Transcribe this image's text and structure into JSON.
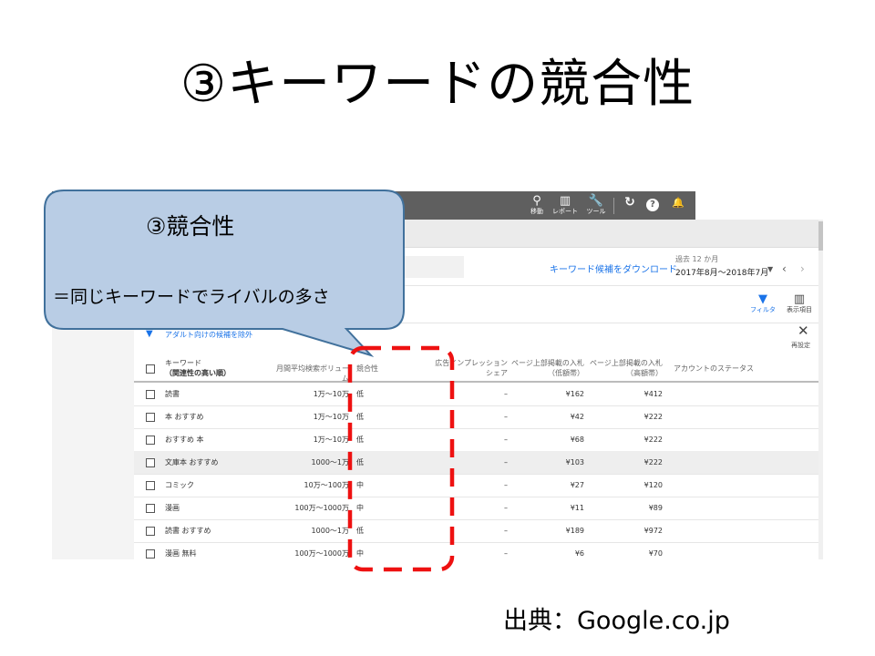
{
  "slide": {
    "title": "③キーワードの競合性",
    "source": "出典：Google.co.jp"
  },
  "callout": {
    "title": "③競合性",
    "text": "＝同じキーワードでライバルの多さ"
  },
  "topbar": {
    "items": [
      {
        "icon": "search-icon",
        "glyph": "⚲",
        "label": "移動"
      },
      {
        "icon": "report-icon",
        "glyph": "▥",
        "label": "レポート"
      },
      {
        "icon": "wrench-icon",
        "glyph": "🔧",
        "label": "ツール"
      }
    ],
    "refresh_glyph": "↻",
    "help_glyph": "?",
    "bell_glyph": "🔔"
  },
  "toolbar": {
    "download_label": "キーワード候補をダウンロード",
    "period_label": "過去 12 か月",
    "period_value": "2017年8月～2018年7月",
    "filter_label": "フィルタ",
    "columns_label": "表示項目",
    "adult_filter": "アダルト向けの候補を除外",
    "reset_label": "再設定"
  },
  "table": {
    "headers": {
      "keyword": "キーワード",
      "keyword_sub": "（関連性の高い順）",
      "volume": "月間平均検索ボリューム",
      "competition": "競合性",
      "impression_1": "広告インプレッション",
      "impression_2": "シェア",
      "bid_low_1": "ページ上部掲載の入札単価",
      "bid_low_2": "（低額帯）",
      "bid_high_1": "ページ上部掲載の入札単価",
      "bid_high_2": "（高額帯）",
      "status": "アカウントのステータス"
    },
    "rows": [
      {
        "keyword": "読書",
        "volume": "1万～10万",
        "competition": "低",
        "impression": "–",
        "bid_low": "¥162",
        "bid_high": "¥412"
      },
      {
        "keyword": "本 おすすめ",
        "volume": "1万～10万",
        "competition": "低",
        "impression": "–",
        "bid_low": "¥42",
        "bid_high": "¥222"
      },
      {
        "keyword": "おすすめ 本",
        "volume": "1万～10万",
        "competition": "低",
        "impression": "–",
        "bid_low": "¥68",
        "bid_high": "¥222"
      },
      {
        "keyword": "文庫本 おすすめ",
        "volume": "1000～1万",
        "competition": "低",
        "impression": "–",
        "bid_low": "¥103",
        "bid_high": "¥222"
      },
      {
        "keyword": "コミック",
        "volume": "10万～100万",
        "competition": "中",
        "impression": "–",
        "bid_low": "¥27",
        "bid_high": "¥120"
      },
      {
        "keyword": "漫画",
        "volume": "100万～1000万",
        "competition": "中",
        "impression": "–",
        "bid_low": "¥11",
        "bid_high": "¥89"
      },
      {
        "keyword": "読書 おすすめ",
        "volume": "1000～1万",
        "competition": "低",
        "impression": "–",
        "bid_low": "¥189",
        "bid_high": "¥972"
      },
      {
        "keyword": "漫画 無料",
        "volume": "100万～1000万",
        "competition": "中",
        "impression": "–",
        "bid_low": "¥6",
        "bid_high": "¥70"
      }
    ]
  },
  "colors": {
    "callout_fill": "#b9cde5",
    "callout_border": "#41719c",
    "highlight_dash": "#ee1111",
    "topbar": "#5f5f5f",
    "link": "#1a73e8"
  }
}
